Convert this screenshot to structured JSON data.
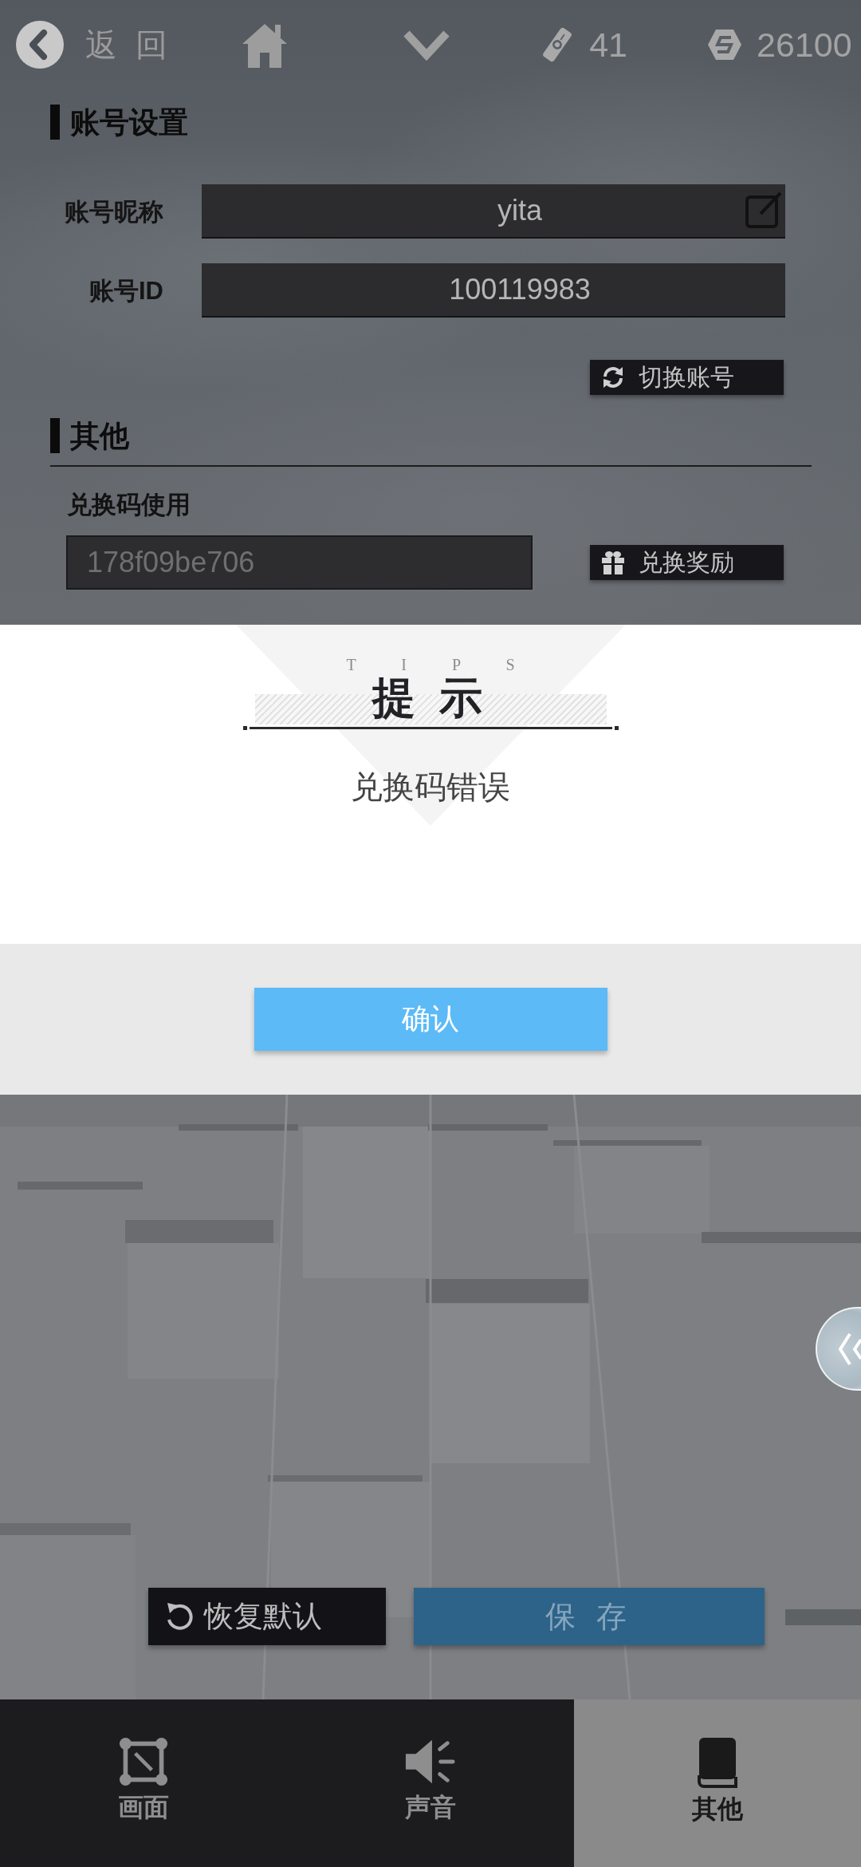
{
  "top_bar": {
    "back_label": "返 回",
    "tickets": "41",
    "coins": "26100"
  },
  "account_section": {
    "title": "账号设置",
    "fields": [
      {
        "label": "账号昵称",
        "value": "yita",
        "editable": true
      },
      {
        "label": "账号ID",
        "value": "100119983",
        "editable": false
      }
    ],
    "switch_button": "切换账号"
  },
  "other_section": {
    "title": "其他",
    "redeem_label": "兑换码使用",
    "redeem_code": "178f09be706",
    "redeem_button": "兑换奖励"
  },
  "dialog": {
    "eyebrow": "T I P S",
    "title": "提 示",
    "message": "兑换码错误",
    "confirm_button": "确认"
  },
  "actions": {
    "reset_button": "恢复默认",
    "save_button": "保 存"
  },
  "tabs": [
    {
      "label": "画面",
      "selected": false
    },
    {
      "label": "声音",
      "selected": false
    },
    {
      "label": "其他",
      "selected": true
    }
  ]
}
